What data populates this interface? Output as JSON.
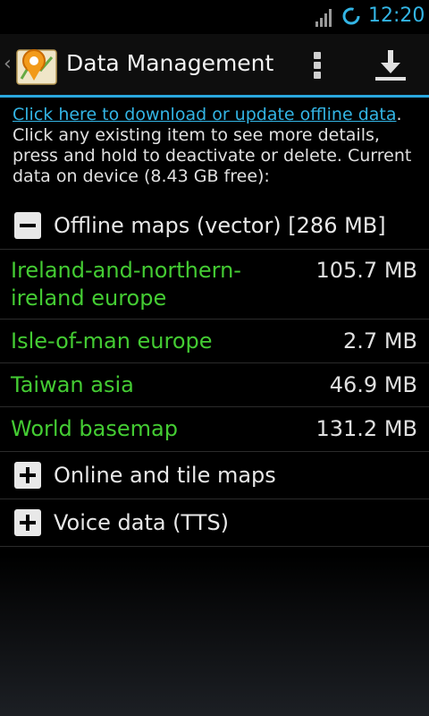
{
  "status_bar": {
    "time": "12:20",
    "icons": [
      "signal-icon",
      "sync-icon"
    ]
  },
  "action_bar": {
    "title": "Data Management",
    "icons": [
      "back-chevron-icon",
      "app-logo-icon",
      "overflow-menu-icon",
      "download-icon"
    ]
  },
  "info": {
    "link_text": "Click here to download or update offline data",
    "after_link": ".",
    "body": "Click any existing item to see more details, press and hold to deactivate or delete. Current data on device (8.43 GB free):"
  },
  "groups": [
    {
      "label": "Offline maps (vector) [286 MB]",
      "expanded": true,
      "items": [
        {
          "name": "Ireland-and-northern-ireland europe",
          "size": "105.7 MB"
        },
        {
          "name": "Isle-of-man europe",
          "size": "2.7 MB"
        },
        {
          "name": "Taiwan asia",
          "size": "46.9 MB"
        },
        {
          "name": "World basemap",
          "size": "131.2 MB"
        }
      ]
    },
    {
      "label": "Online and tile maps",
      "expanded": false
    },
    {
      "label": "Voice data (TTS)",
      "expanded": false
    }
  ],
  "colors": {
    "accent": "#33b5e5",
    "item_name": "#44cc33",
    "background": "#000000"
  }
}
